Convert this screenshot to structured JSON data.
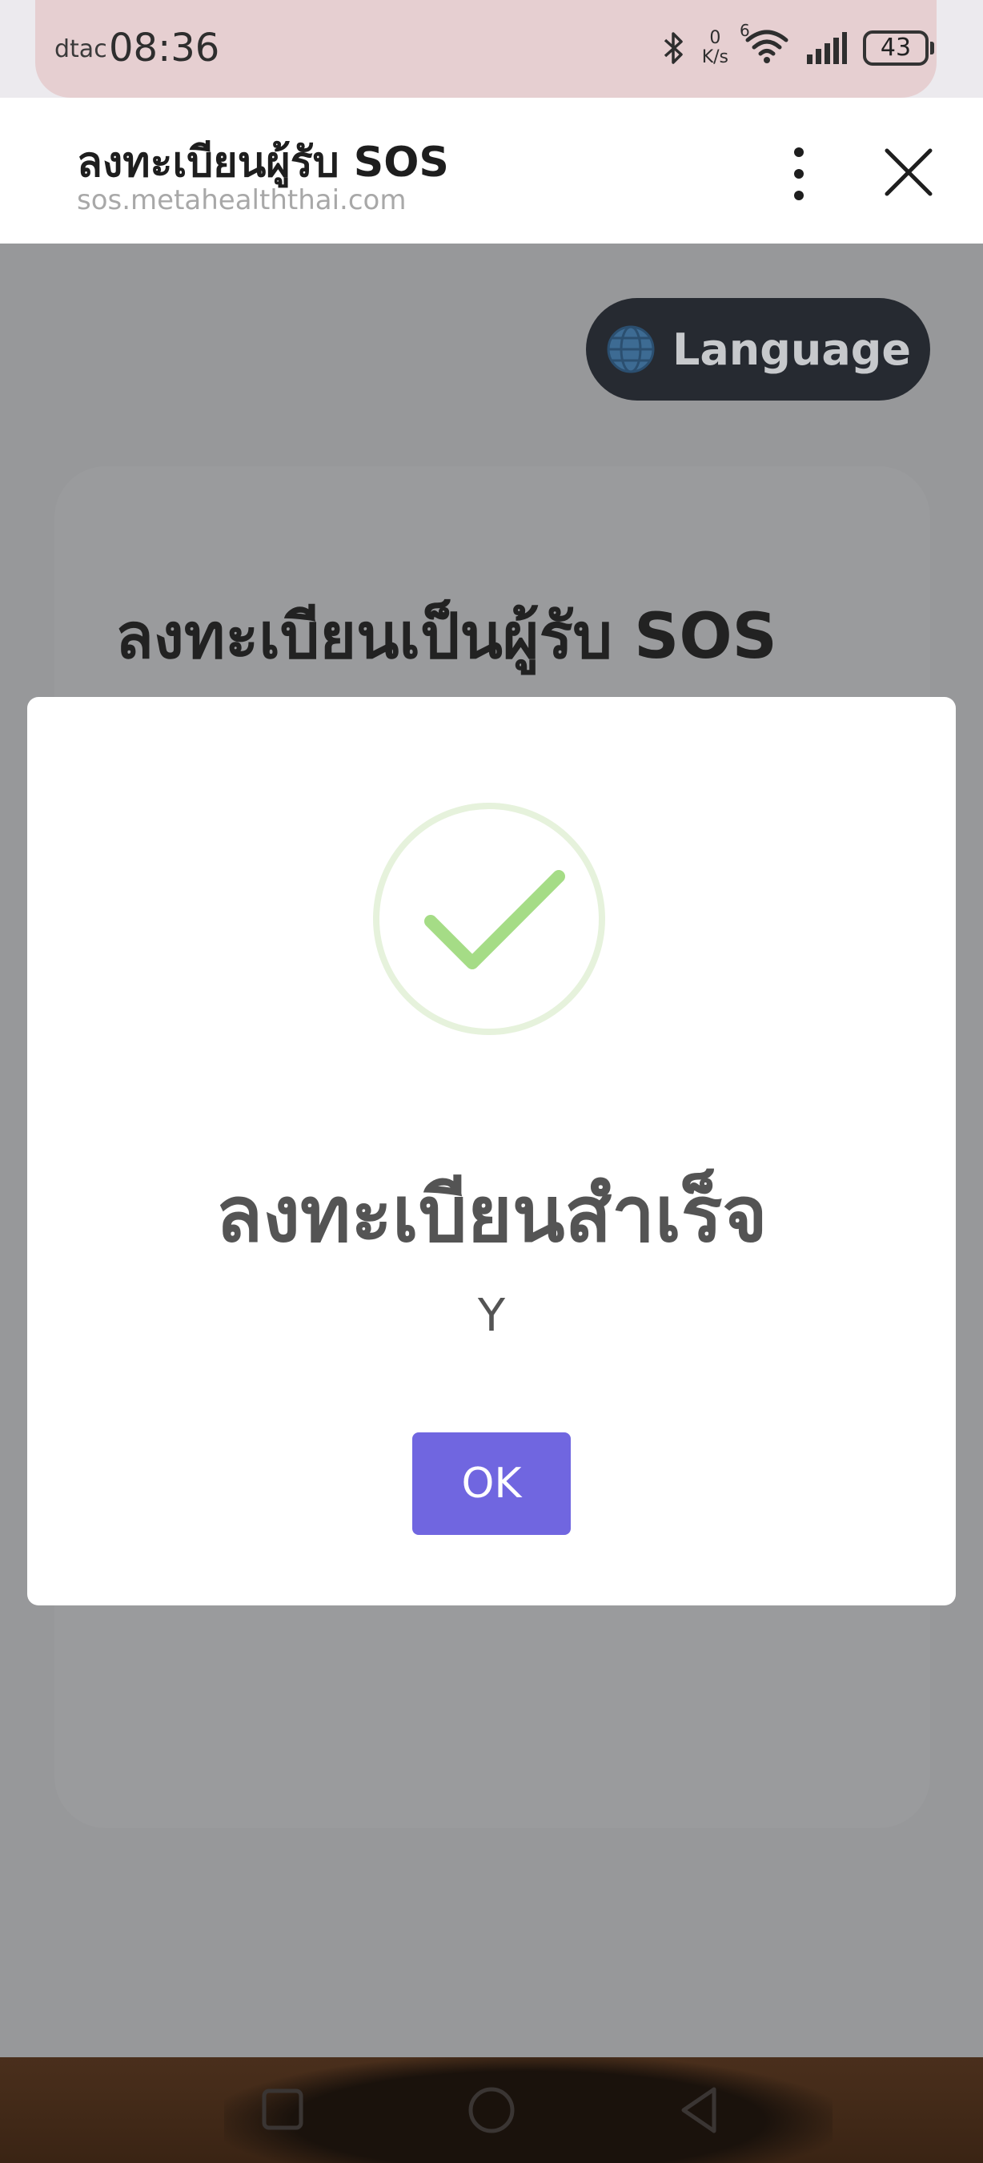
{
  "status_bar": {
    "carrier": "dtac",
    "time": "08:36",
    "net_speed_value": "0",
    "net_speed_unit": "K/s",
    "wifi_label": "6",
    "battery": "43"
  },
  "browser": {
    "title": "ลงทะเบียนผู้รับ SOS",
    "url": "sos.metahealththai.com"
  },
  "page": {
    "language_button": "Language",
    "card_title": "ลงทะเบียนเป็นผู้รับ SOS"
  },
  "modal": {
    "title": "ลงทะเบียนสำเร็จ",
    "text": "Y",
    "ok_label": "OK",
    "success_color": "#a5dc86",
    "button_color": "#7066e0"
  },
  "icons": {
    "bluetooth": "bluetooth-icon",
    "wifi": "wifi-icon",
    "signal": "signal-icon",
    "menu": "more-vertical-icon",
    "close": "close-icon",
    "globe": "globe-icon",
    "check": "check-icon",
    "nav_recent": "recent-apps-icon",
    "nav_home": "home-icon",
    "nav_back": "back-icon"
  }
}
